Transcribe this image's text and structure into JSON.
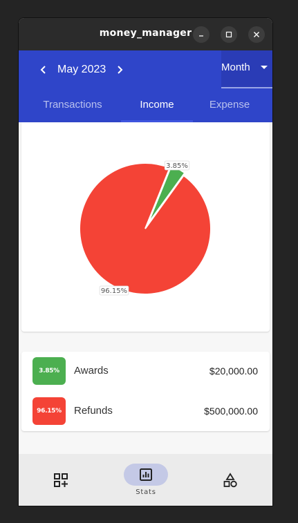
{
  "window": {
    "title": "money_manager"
  },
  "header": {
    "month": "May 2023",
    "period": "Month",
    "tabs": [
      {
        "label": "Transactions",
        "active": false
      },
      {
        "label": "Income",
        "active": true
      },
      {
        "label": "Expense",
        "active": false
      }
    ]
  },
  "chart_data": {
    "type": "pie",
    "slices": [
      {
        "label": "Awards",
        "value": 3.85,
        "display": "3.85%",
        "color": "#4caf50"
      },
      {
        "label": "Refunds",
        "value": 96.15,
        "display": "96.15%",
        "color": "#f44336"
      }
    ]
  },
  "legend": [
    {
      "percent": "3.85%",
      "name": "Awards",
      "amount": "$20,000.00",
      "color": "#4caf50"
    },
    {
      "percent": "96.15%",
      "name": "Refunds",
      "amount": "$500,000.00",
      "color": "#f44336"
    }
  ],
  "nav": {
    "items": [
      {
        "icon": "category-add-icon",
        "label": ""
      },
      {
        "icon": "stats-icon",
        "label": "Stats",
        "active": true
      },
      {
        "icon": "shapes-icon",
        "label": ""
      }
    ]
  },
  "colors": {
    "primary": "#2f45c9",
    "income": "#4caf50",
    "expense": "#f44336"
  }
}
